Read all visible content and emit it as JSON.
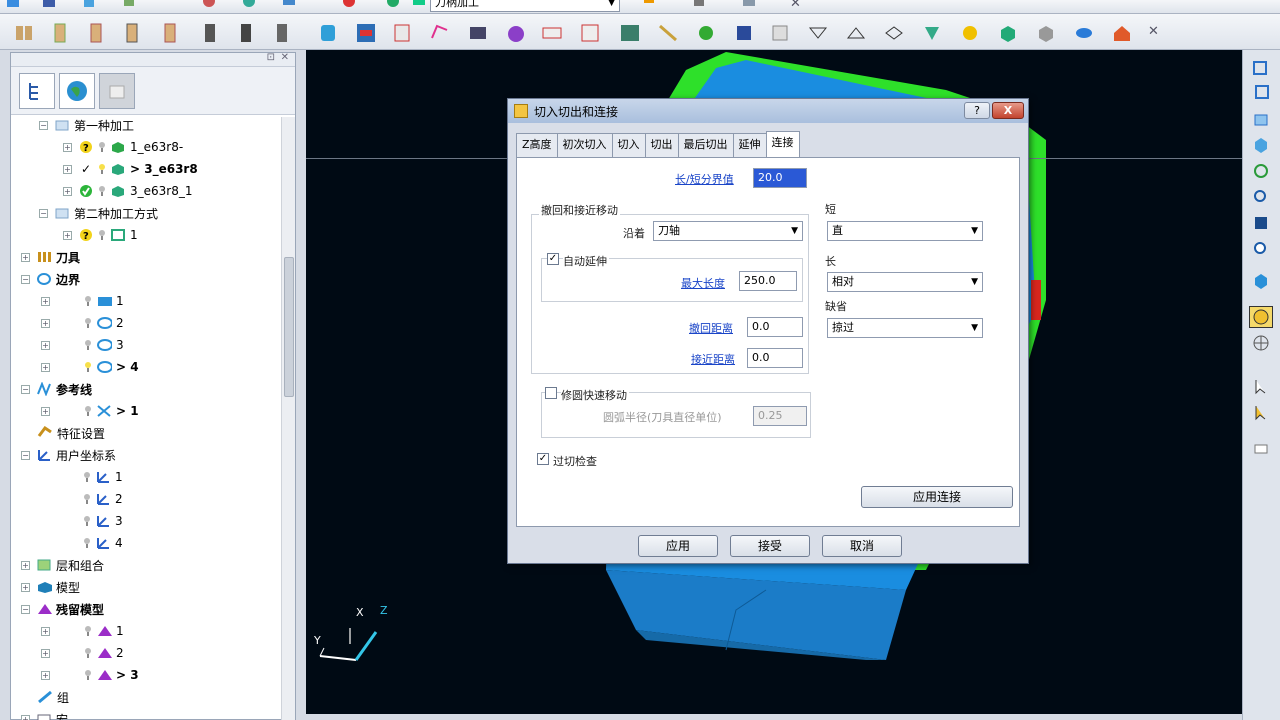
{
  "toolbar_top": {
    "combo_value": "刀柄加工"
  },
  "left_panel": {
    "tree": [
      {
        "label": "第一种加工",
        "bold": false
      },
      {
        "label": "1_e63r8-",
        "bold": false
      },
      {
        "label": "> 3_e63r8",
        "bold": true
      },
      {
        "label": "3_e63r8_1",
        "bold": false
      },
      {
        "label": "第二种加工方式",
        "bold": false
      },
      {
        "label": "1",
        "bold": false
      },
      {
        "label": "刀具",
        "bold": true
      },
      {
        "label": "边界",
        "bold": true
      },
      {
        "label": "1",
        "bold": false
      },
      {
        "label": "2",
        "bold": false
      },
      {
        "label": "3",
        "bold": false
      },
      {
        "label": "> 4",
        "bold": true
      },
      {
        "label": "参考线",
        "bold": true
      },
      {
        "label": "> 1",
        "bold": true
      },
      {
        "label": "特征设置",
        "bold": false
      },
      {
        "label": "用户坐标系",
        "bold": false
      },
      {
        "label": "1",
        "bold": false
      },
      {
        "label": "2",
        "bold": false
      },
      {
        "label": "3",
        "bold": false
      },
      {
        "label": "4",
        "bold": false
      },
      {
        "label": "层和组合",
        "bold": false
      },
      {
        "label": "模型",
        "bold": false
      },
      {
        "label": "残留模型",
        "bold": true
      },
      {
        "label": "1",
        "bold": false
      },
      {
        "label": "2",
        "bold": false
      },
      {
        "label": "> 3",
        "bold": true
      },
      {
        "label": "组",
        "bold": false
      },
      {
        "label": "宏",
        "bold": false
      }
    ]
  },
  "viewport": {
    "axis_labels": {
      "x": "X",
      "y": "Y",
      "z": "Z"
    }
  },
  "dialog": {
    "title": "切入切出和连接",
    "help_label": "?",
    "close_label": "X",
    "tabs": [
      "Z高度",
      "初次切入",
      "切入",
      "切出",
      "最后切出",
      "延伸",
      "连接"
    ],
    "active_tab": "连接",
    "length_threshold_label": "长/短分界值",
    "length_threshold_value": "20.0",
    "retract_group_label": "撤回和接近移动",
    "along_label": "沿着",
    "along_value": "刀轴",
    "auto_extend_label": "自动延伸",
    "auto_extend_checked": true,
    "max_length_label": "最大长度",
    "max_length_value": "250.0",
    "retract_distance_label": "撤回距离",
    "retract_distance_value": "0.0",
    "approach_distance_label": "接近距离",
    "approach_distance_value": "0.0",
    "short_label": "短",
    "short_value": "直",
    "long_label": "长",
    "long_value": "相对",
    "default_label": "缺省",
    "default_value": "掠过",
    "fillet_rapid_label": "修圆快速移动",
    "fillet_rapid_checked": false,
    "arc_radius_label": "圆弧半径(刀具直径单位)",
    "arc_radius_value": "0.25",
    "gouge_check_label": "过切检查",
    "gouge_check_checked": true,
    "apply_links_label": "应用连接",
    "apply_label": "应用",
    "accept_label": "接受",
    "cancel_label": "取消"
  }
}
